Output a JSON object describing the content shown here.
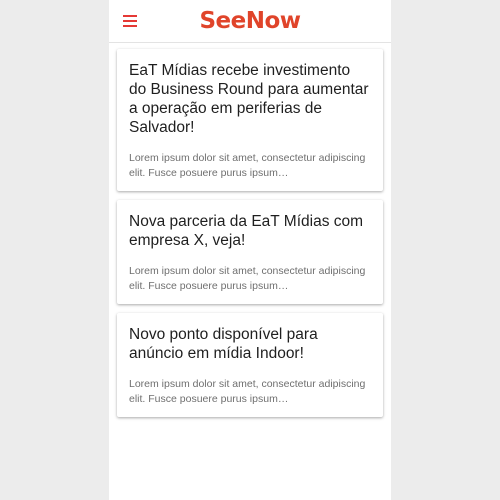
{
  "app": {
    "logo": "SeeNow",
    "menu_icon": "hamburger-menu-icon",
    "accent_color": "#e53935",
    "logo_color": "#e0442a"
  },
  "feed": {
    "items": [
      {
        "title": "EaT Mídias recebe investimento do Business Round para aumentar a operação em periferias de Salvador!",
        "excerpt": "Lorem ipsum dolor sit amet, consectetur adipiscing elit. Fusce posuere purus ipsum…"
      },
      {
        "title": "Nova parceria da EaT Mídias com empresa X, veja!",
        "excerpt": "Lorem ipsum dolor sit amet, consectetur adipiscing elit. Fusce posuere purus ipsum…"
      },
      {
        "title": "Novo ponto disponível para anúncio em mídia Indoor!",
        "excerpt": "Lorem ipsum dolor sit amet, consectetur adipiscing elit. Fusce posuere purus ipsum…"
      }
    ]
  }
}
